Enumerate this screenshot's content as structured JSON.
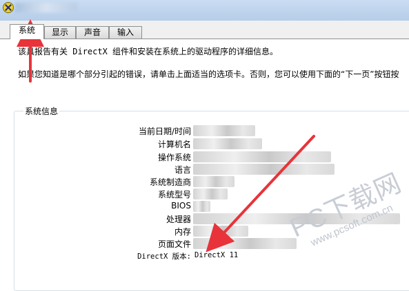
{
  "window": {
    "icon": "directx-icon"
  },
  "tabs": [
    {
      "label": "系统",
      "active": true
    },
    {
      "label": "显示",
      "active": false
    },
    {
      "label": "声音",
      "active": false
    },
    {
      "label": "输入",
      "active": false
    }
  ],
  "intro": {
    "line1_prefix": "该",
    "line1_rest": "具报告有关 DirectX 组件和安装在系统上的驱动程序的详细信息。",
    "line2_prefix": "如果",
    "line2_rest": "您知道是哪个部分引起的错误，请单击上面适当的选项卡。否则，您可以使用下面的“下一页”按钮按"
  },
  "system_info": {
    "group_title": "系统信息",
    "rows": [
      {
        "label": "当前日期/时间"
      },
      {
        "label": "计算机名"
      },
      {
        "label": "操作系统"
      },
      {
        "label": "语言"
      },
      {
        "label": "系统制造商"
      },
      {
        "label": "系统型号"
      },
      {
        "label": "BIOS"
      },
      {
        "label": "处理器"
      },
      {
        "label": "内存"
      },
      {
        "label": "页面文件"
      }
    ],
    "directx": {
      "label": "DirectX 版本:",
      "value": "DirectX 11"
    }
  },
  "watermark": {
    "brand": "PC下载网",
    "url": "www.pcsoft.com.cn"
  },
  "colors": {
    "arrow": "#e8333a",
    "tab_border": "#8e8f8f",
    "titlebar": "#bcd1ea"
  }
}
